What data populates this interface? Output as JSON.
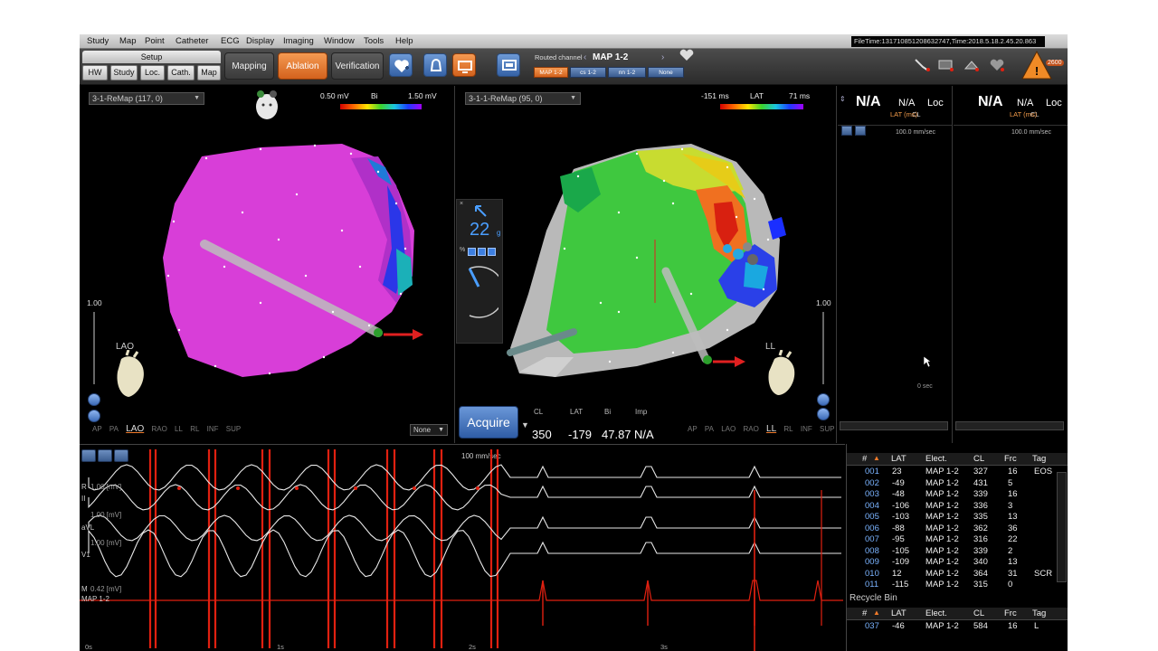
{
  "menu": [
    "Study",
    "Map",
    "Point",
    "Catheter",
    "ECG",
    "Display",
    "Imaging",
    "Window",
    "Tools",
    "Help"
  ],
  "file_time": "FileTime:131710851208632747,Time:2018.5.18.2.45.20.863",
  "toolbar": {
    "setup_label": "Setup",
    "setup_buttons": [
      "HW",
      "Study",
      "Loc.",
      "Cath.",
      "Map"
    ],
    "mode_buttons": [
      "Mapping",
      "Ablation",
      "Verification"
    ],
    "active_mode": "Ablation",
    "routed_label": "Routed channel",
    "routed_value": "MAP 1-2",
    "channels": [
      "MAP 1-2",
      "cs 1-2",
      "nn 1-2",
      "None"
    ],
    "warning_count": "2600"
  },
  "map_left": {
    "map_name": "3-1-ReMap (117, 0)",
    "scale_min": "0.50 mV",
    "scale_name": "Bi",
    "scale_max": "1.50 mV",
    "slider_value": "1.00",
    "view_label": "LAO",
    "views": [
      "AP",
      "PA",
      "LAO",
      "RAO",
      "LL",
      "RL",
      "INF",
      "SUP"
    ],
    "selected_view": "LAO",
    "none_select": "None"
  },
  "map_right": {
    "map_name": "3-1-1-ReMap (95, 0)",
    "scale_min": "-151 ms",
    "scale_name": "LAT",
    "scale_max": "71 ms",
    "slider_value": "1.00",
    "view_label": "LL",
    "views": [
      "AP",
      "PA",
      "LAO",
      "RAO",
      "LL",
      "RL",
      "INF",
      "SUP"
    ],
    "selected_view": "LL",
    "force_value": "22",
    "force_unit": "g",
    "acquire_label": "Acquire",
    "acq_headers": [
      "CL",
      "LAT",
      "Bi",
      "Imp"
    ],
    "acq_values": [
      "350",
      "-179",
      "47.87",
      "N/A"
    ]
  },
  "signal_cols": [
    {
      "big": "N/A",
      "med1": "N/A",
      "med2": "Loc",
      "sub1": "CL",
      "sub2": "LAT (ms)",
      "speed": "100.0 mm/sec",
      "zero": "0 sec"
    },
    {
      "big": "N/A",
      "med1": "N/A",
      "med2": "Loc",
      "sub1": "CL",
      "sub2": "LAT (ms)",
      "speed": "100.0 mm/sec"
    }
  ],
  "ecg": {
    "speed": "100 mm/sec",
    "leads": [
      "R",
      "II",
      "aVL",
      "V1",
      "M",
      "MAP 1-2"
    ],
    "scales": [
      "1.00 [mV]",
      "1.00 [mV]",
      "1.00 [mV]",
      "0.42 [mV]"
    ],
    "time_labels": [
      "0s",
      "1s",
      "2s",
      "3s"
    ]
  },
  "points": {
    "headers": [
      "#",
      "LAT",
      "Elect.",
      "CL",
      "Frc",
      "Tag"
    ],
    "rows": [
      [
        "001",
        "23",
        "MAP 1-2",
        "327",
        "16",
        "EOS"
      ],
      [
        "002",
        "-49",
        "MAP 1-2",
        "431",
        "5",
        ""
      ],
      [
        "003",
        "-48",
        "MAP 1-2",
        "339",
        "16",
        ""
      ],
      [
        "004",
        "-106",
        "MAP 1-2",
        "336",
        "3",
        ""
      ],
      [
        "005",
        "-103",
        "MAP 1-2",
        "335",
        "13",
        ""
      ],
      [
        "006",
        "-88",
        "MAP 1-2",
        "362",
        "36",
        ""
      ],
      [
        "007",
        "-95",
        "MAP 1-2",
        "316",
        "22",
        ""
      ],
      [
        "008",
        "-105",
        "MAP 1-2",
        "339",
        "2",
        ""
      ],
      [
        "009",
        "-109",
        "MAP 1-2",
        "340",
        "13",
        ""
      ],
      [
        "010",
        "12",
        "MAP 1-2",
        "364",
        "31",
        "SCR"
      ],
      [
        "011",
        "-115",
        "MAP 1-2",
        "315",
        "0",
        ""
      ]
    ],
    "recycle_title": "Recycle Bin",
    "recycle_rows": [
      [
        "037",
        "-46",
        "MAP 1-2",
        "584",
        "16",
        "L"
      ]
    ]
  },
  "colors": {
    "accent": "#e2782e",
    "button_blue": "#3c6bb8",
    "ecg_red": "#e02010"
  }
}
